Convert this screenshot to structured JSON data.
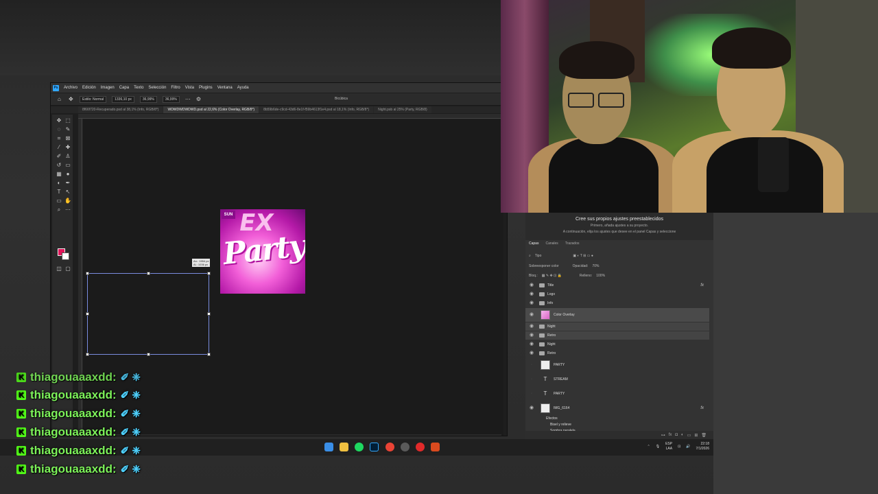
{
  "photoshop": {
    "logo": "Ps",
    "menu": [
      "Archivo",
      "Edición",
      "Imagen",
      "Capa",
      "Texto",
      "Selección",
      "Filtro",
      "Vista",
      "Plugins",
      "Ventana",
      "Ayuda"
    ],
    "options": {
      "style": "Estilo: Normal",
      "width": "1336,10 px",
      "zoom": "36,99%",
      "height": "36,99%",
      "interpolation": "Bicúbica"
    },
    "tabs": [
      "8f66f720-Recuperado.psd al 38,1% (Info, RGB/8*)",
      "WDWDWDWDWD.psd al 22,6% (Color Overlay, RGB/8*)",
      "8b59b6de-c9cd-43d6-8e1f-f59b4613f1e4.psd al 18,1% (Info, RGB/8*)",
      "Night.psb al 25% (Party, RGB/8)"
    ],
    "active_tab": 1,
    "doc_badge": "SUN",
    "doc_text_top": "EX",
    "doc_text_main": "Party",
    "size_tip": {
      "w": "An.: 1554 px",
      "h": "Al.: 1036 px"
    }
  },
  "layers_panel": {
    "adj_title": "Cree sus propios ajustes preestablecidos",
    "adj_line1": "Primero, añada ajustes a su proyecto.",
    "adj_line2": "A continuación, elija los ajustes que desee en el panel Capas y seleccione",
    "tabs": [
      "Capas",
      "Canales",
      "Trazados"
    ],
    "filter": "Tipo",
    "blend_mode": "Sobreexponer color",
    "opacity_label": "Opacidad:",
    "opacity": "70%",
    "lock_label": "Bloq.:",
    "fill_label": "Relleno:",
    "fill": "100%",
    "layers": [
      {
        "name": "Title",
        "kind": "folder",
        "fx": true
      },
      {
        "name": "Logo",
        "kind": "folder"
      },
      {
        "name": "Info",
        "kind": "folder"
      },
      {
        "name": "Color Overlay",
        "kind": "thumb-pink"
      },
      {
        "name": "Night",
        "kind": "folder"
      },
      {
        "name": "Retro",
        "kind": "folder"
      },
      {
        "name": "Night",
        "kind": "folder"
      },
      {
        "name": "Retro",
        "kind": "folder"
      },
      {
        "name": "PARTY",
        "kind": "thumb"
      },
      {
        "name": "STREAM",
        "kind": "text"
      },
      {
        "name": "PARTY",
        "kind": "text"
      },
      {
        "name": "IMG_6164",
        "kind": "thumb",
        "fx": true
      }
    ],
    "effects_label": "Efectos",
    "effect1": "Bisel y relieve",
    "effect2": "Sombra paralela"
  },
  "taskbar": {
    "lang": "ESP",
    "lang2": "LAA",
    "time": "22:18",
    "date": "7/1/2026"
  },
  "chat": {
    "username": "thiagouaaaxdd:",
    "lines": 6
  }
}
